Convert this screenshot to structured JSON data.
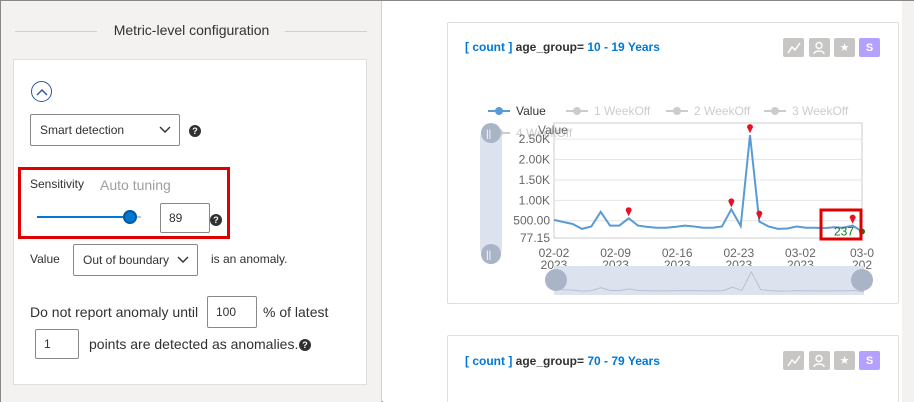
{
  "left": {
    "section_title": "Metric-level configuration",
    "detection_select": "Smart detection",
    "sensitivity_label": "Sensitivity",
    "auto_tuning": "Auto tuning",
    "sensitivity_value": "89",
    "sensitivity_level": 89,
    "value_label": "Value",
    "boundary_select": "Out of boundary",
    "anomaly_suffix": "is an anomaly.",
    "report_prefix": "Do not report anomaly until",
    "report_percent": "100",
    "report_percent_suffix": "% of latest",
    "report_points": "1",
    "report_points_suffix": "points are detected as anomalies."
  },
  "cards": [
    {
      "tag": "[ count ]",
      "dim": "age_group=",
      "value": "10 - 19 Years",
      "actions": [
        "chart-edit-icon",
        "person-icon",
        "star-icon",
        "S"
      ]
    },
    {
      "tag": "[ count ]",
      "dim": "age_group=",
      "value": "70 - 79 Years",
      "actions": [
        "chart-edit-icon",
        "person-icon",
        "star-icon",
        "S"
      ]
    }
  ],
  "chart_data": {
    "type": "line",
    "ylabel": "Value",
    "legend": [
      "Value",
      "1 WeekOff",
      "2 WeekOff",
      "3 WeekOff"
    ],
    "legend_extra": "4 WeekOff",
    "y_ticks": [
      "2.50K",
      "2.00K",
      "1.50K",
      "1.00K",
      "500.00",
      "77.15"
    ],
    "x_ticks": [
      {
        "d": "02-02",
        "y": "2023"
      },
      {
        "d": "02-09",
        "y": "2023"
      },
      {
        "d": "02-16",
        "y": "2023"
      },
      {
        "d": "02-23",
        "y": "2023"
      },
      {
        "d": "03-02",
        "y": "2023"
      },
      {
        "d": "03-0",
        "y": "202"
      }
    ],
    "ylim": [
      77.15,
      2700
    ],
    "series": [
      {
        "name": "Value",
        "values": [
          520,
          470,
          420,
          300,
          360,
          720,
          380,
          380,
          560,
          380,
          350,
          330,
          330,
          350,
          380,
          360,
          330,
          330,
          360,
          780,
          370,
          2600,
          480,
          360,
          300,
          310,
          360,
          330,
          330,
          320,
          340,
          330,
          380,
          237
        ]
      }
    ],
    "anomalies": [
      8,
      19,
      21,
      22,
      32
    ],
    "last_label": "237",
    "accent": "#5b9bd5",
    "anomaly_color": "#e81123",
    "last_point_color": "#107c10"
  }
}
